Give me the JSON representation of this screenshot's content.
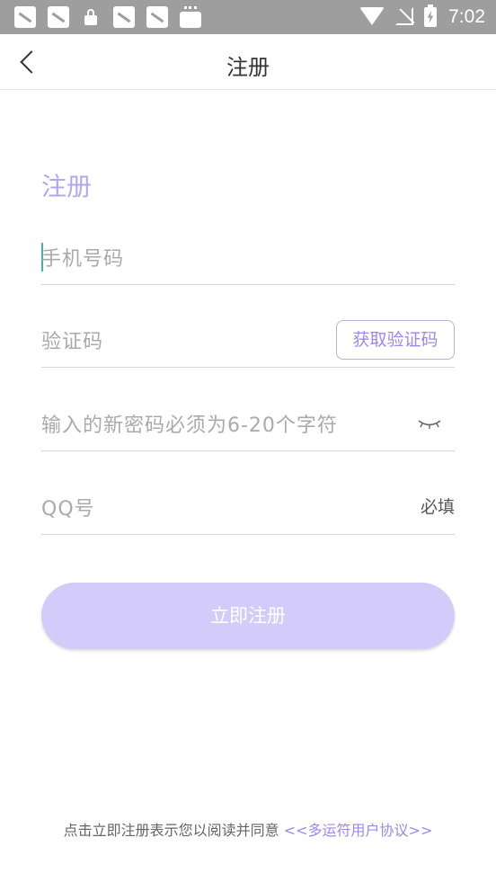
{
  "status_bar": {
    "time": "7:02",
    "icons": [
      "notification-icon",
      "notification-icon",
      "lock-icon",
      "notification-icon",
      "notification-icon",
      "shopping-bag-icon",
      "wifi-icon",
      "no-signal-icon",
      "battery-charging-icon"
    ]
  },
  "header": {
    "back_icon": "chevron-left-icon",
    "title": "注册"
  },
  "form": {
    "heading": "注册",
    "phone_placeholder": "手机号码",
    "code_placeholder": "验证码",
    "get_code_label": "获取验证码",
    "password_placeholder": "输入的新密码必须为6-20个字符",
    "password_toggle_icon": "eye-closed-icon",
    "qq_placeholder": "QQ号",
    "qq_required_label": "必填",
    "submit_label": "立即注册"
  },
  "footer": {
    "agreement_text": "点击立即注册表示您以阅读并同意 ",
    "agreement_link": "<<多运符用户协议>>"
  },
  "colors": {
    "accent": "#9b88ee",
    "heading": "#b4a7f0",
    "submit_bg": "#d3ccfb",
    "status_bar": "#9e9e9e",
    "cursor": "#46b4a4"
  }
}
